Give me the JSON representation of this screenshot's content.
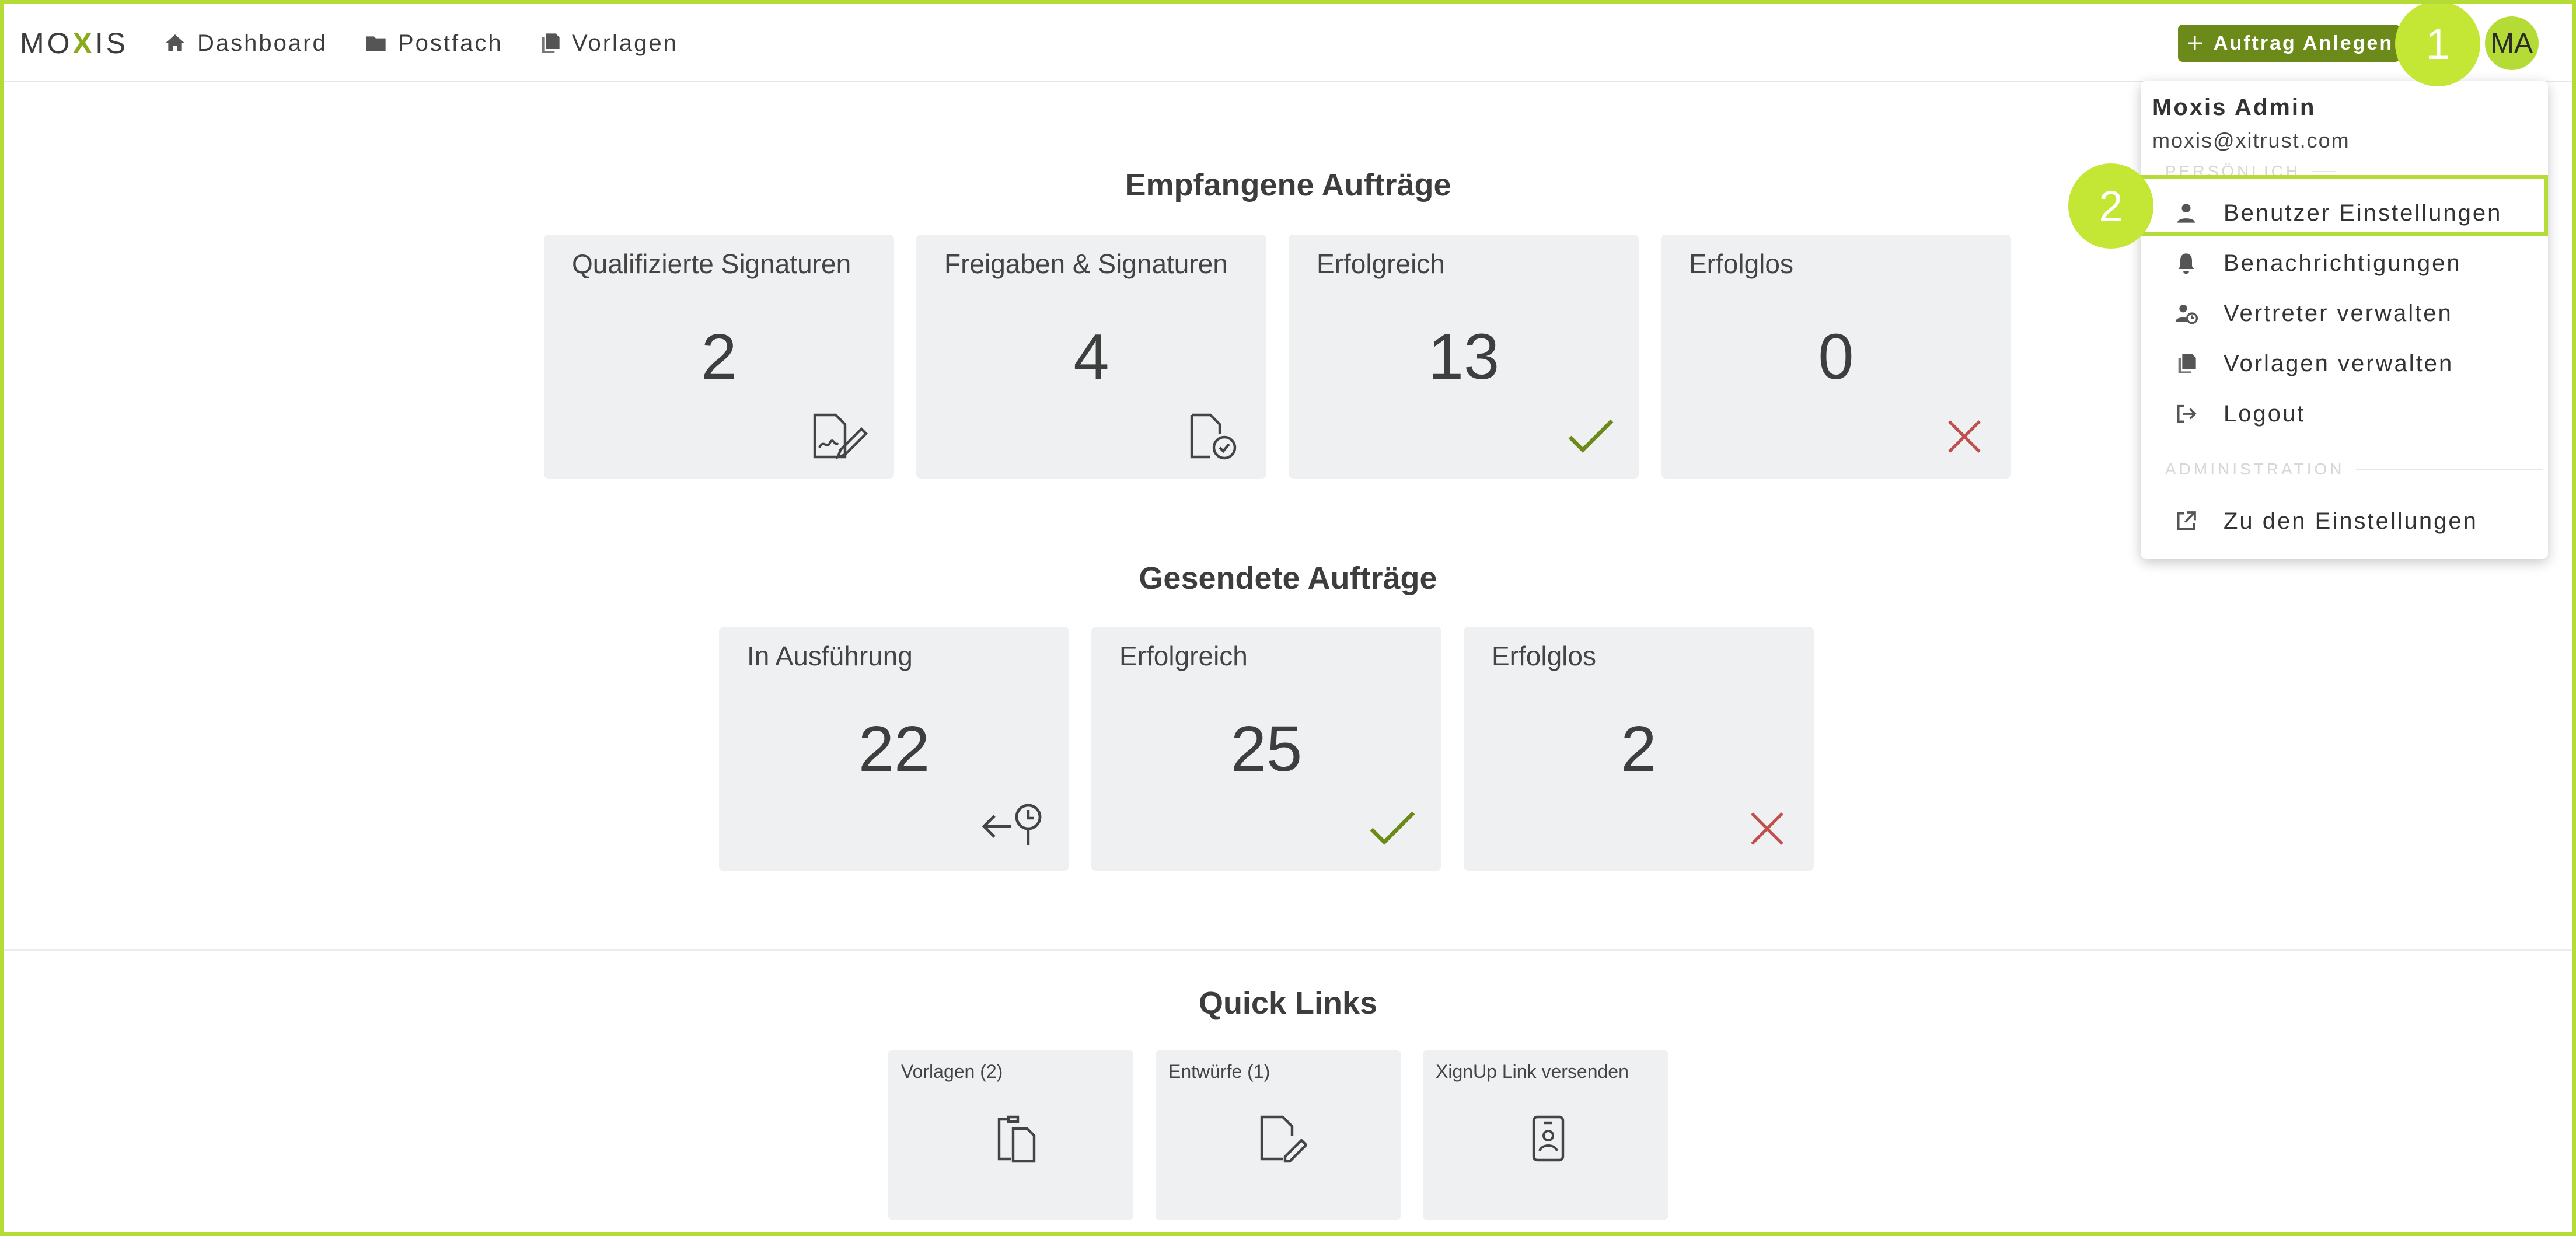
{
  "app": {
    "logo_left": "MO",
    "logo_x": "X",
    "logo_right": "IS"
  },
  "nav": {
    "dashboard": "Dashboard",
    "inbox": "Postfach",
    "templates": "Vorlagen"
  },
  "header": {
    "create_button": "Auftrag Anlegen",
    "avatar_initials": "MA"
  },
  "steps": {
    "one": "1",
    "two": "2"
  },
  "received": {
    "title": "Empfangene Aufträge",
    "cards": [
      {
        "label": "Qualifizierte Signaturen",
        "value": "2",
        "icon": "signature-document-icon"
      },
      {
        "label": "Freigaben & Signaturen",
        "value": "4",
        "icon": "document-check-icon"
      },
      {
        "label": "Erfolgreich",
        "value": "13",
        "icon": "check-icon"
      },
      {
        "label": "Erfolglos",
        "value": "0",
        "icon": "cross-icon"
      }
    ]
  },
  "sent": {
    "title": "Gesendete Aufträge",
    "cards": [
      {
        "label": "In Ausführung",
        "value": "22",
        "icon": "arrow-clock-icon"
      },
      {
        "label": "Erfolgreich",
        "value": "25",
        "icon": "check-icon"
      },
      {
        "label": "Erfolglos",
        "value": "2",
        "icon": "cross-icon"
      }
    ]
  },
  "quick_links": {
    "title": "Quick Links",
    "items": [
      {
        "label": "Vorlagen (2)",
        "icon": "clipboard-document-icon"
      },
      {
        "label": "Entwürfe (1)",
        "icon": "document-edit-icon"
      },
      {
        "label": "XignUp Link versenden",
        "icon": "id-badge-icon"
      }
    ]
  },
  "user_menu": {
    "name": "Moxis Admin",
    "email": "moxis@xitrust.com",
    "section_personal": "PERSÖNLICH",
    "items": [
      {
        "label": "Benutzer Einstellungen",
        "icon": "user-icon"
      },
      {
        "label": "Benachrichtigungen",
        "icon": "bell-icon"
      },
      {
        "label": "Vertreter verwalten",
        "icon": "user-clock-icon"
      },
      {
        "label": "Vorlagen verwalten",
        "icon": "copy-icon"
      },
      {
        "label": "Logout",
        "icon": "logout-icon"
      }
    ],
    "section_admin": "ADMINISTRATION",
    "admin_items": [
      {
        "label": "Zu den Einstellungen",
        "icon": "external-link-icon"
      }
    ]
  },
  "colors": {
    "accent": "#b5dc36",
    "button": "#6b8a1a",
    "success": "#6b8a1a",
    "error": "#c0504d"
  }
}
